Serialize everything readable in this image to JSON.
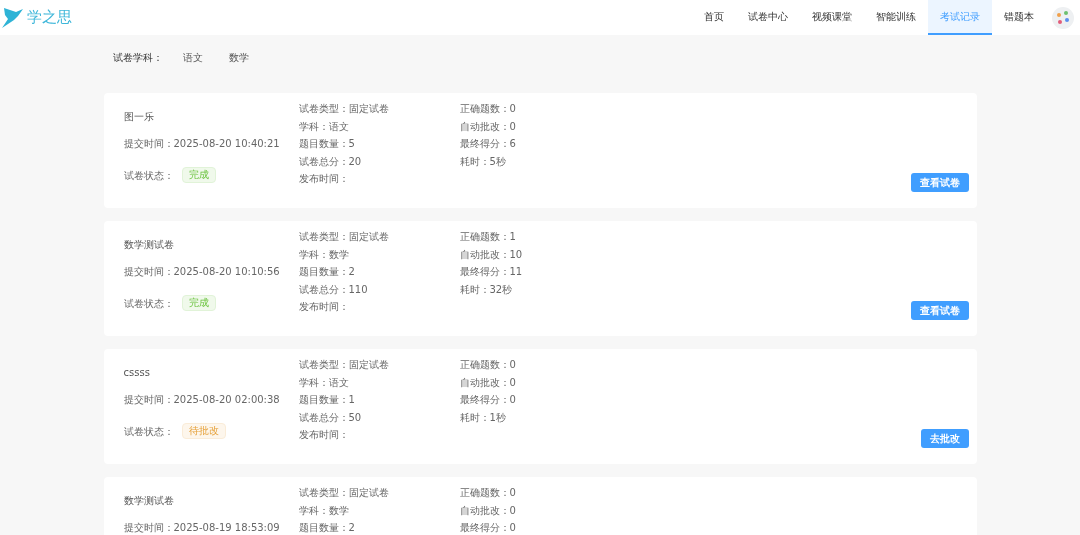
{
  "logo": {
    "text": "学之思"
  },
  "nav": [
    {
      "label": "首页",
      "selected": false
    },
    {
      "label": "试卷中心",
      "selected": false
    },
    {
      "label": "视频课堂",
      "selected": false
    },
    {
      "label": "智能训练",
      "selected": false
    },
    {
      "label": "考试记录",
      "selected": true
    },
    {
      "label": "错题本",
      "selected": false
    }
  ],
  "filter": {
    "label": "试卷学科：",
    "options": [
      "语文",
      "数学"
    ]
  },
  "records": [
    {
      "title": "图一乐",
      "submitted": "提交时间：2025-08-20 10:40:21",
      "status": {
        "label": "试卷状态：",
        "value": "完成",
        "kind": "done"
      },
      "middle": [
        "试卷类型：固定试卷",
        "学科：语文",
        "题目数量：5",
        "试卷总分：20",
        "发布时间："
      ],
      "right": [
        "正确题数：0",
        "自动批改：0",
        "最终得分：6",
        "耗时：5秒"
      ],
      "button": "查看试卷"
    },
    {
      "title": "数学测试卷",
      "submitted": "提交时间：2025-08-20 10:10:56",
      "status": {
        "label": "试卷状态：",
        "value": "完成",
        "kind": "done"
      },
      "middle": [
        "试卷类型：固定试卷",
        "学科：数学",
        "题目数量：2",
        "试卷总分：110",
        "发布时间："
      ],
      "right": [
        "正确题数：1",
        "自动批改：10",
        "最终得分：11",
        "耗时：32秒"
      ],
      "button": "查看试卷"
    },
    {
      "title": "cssss",
      "submitted": "提交时间：2025-08-20 02:00:38",
      "status": {
        "label": "试卷状态：",
        "value": "待批改",
        "kind": "pending"
      },
      "middle": [
        "试卷类型：固定试卷",
        "学科：语文",
        "题目数量：1",
        "试卷总分：50",
        "发布时间："
      ],
      "right": [
        "正确题数：0",
        "自动批改：0",
        "最终得分：0",
        "耗时：1秒"
      ],
      "button": "去批改"
    },
    {
      "title": "数学测试卷",
      "submitted": "提交时间：2025-08-19 18:53:09",
      "middle": [
        "试卷类型：固定试卷",
        "学科：数学",
        "题目数量：2"
      ],
      "right": [
        "正确题数：0",
        "自动批改：0",
        "最终得分：0"
      ]
    }
  ]
}
